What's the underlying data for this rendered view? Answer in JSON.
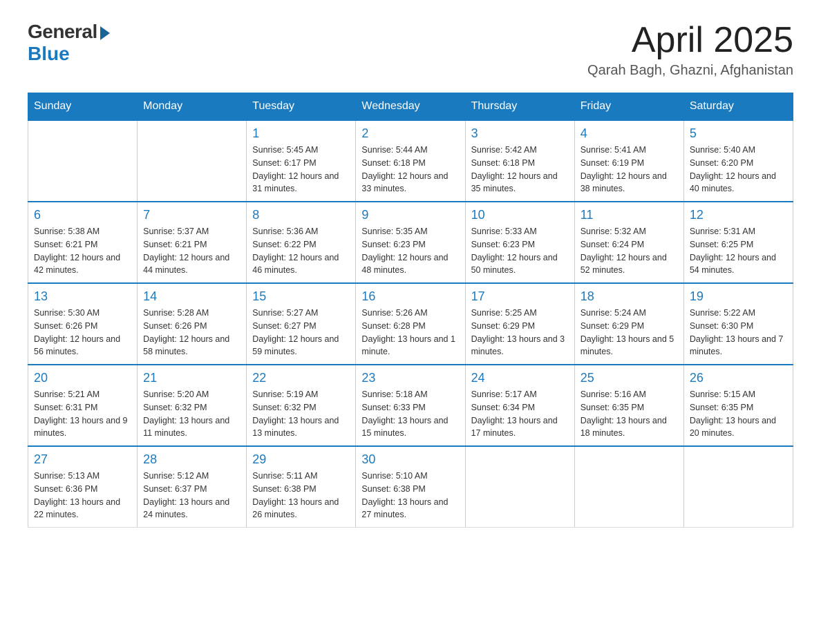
{
  "header": {
    "logo_general": "General",
    "logo_blue": "Blue",
    "month_title": "April 2025",
    "location": "Qarah Bagh, Ghazni, Afghanistan"
  },
  "calendar": {
    "days_of_week": [
      "Sunday",
      "Monday",
      "Tuesday",
      "Wednesday",
      "Thursday",
      "Friday",
      "Saturday"
    ],
    "weeks": [
      [
        {
          "day": "",
          "sunrise": "",
          "sunset": "",
          "daylight": ""
        },
        {
          "day": "",
          "sunrise": "",
          "sunset": "",
          "daylight": ""
        },
        {
          "day": "1",
          "sunrise": "Sunrise: 5:45 AM",
          "sunset": "Sunset: 6:17 PM",
          "daylight": "Daylight: 12 hours and 31 minutes."
        },
        {
          "day": "2",
          "sunrise": "Sunrise: 5:44 AM",
          "sunset": "Sunset: 6:18 PM",
          "daylight": "Daylight: 12 hours and 33 minutes."
        },
        {
          "day": "3",
          "sunrise": "Sunrise: 5:42 AM",
          "sunset": "Sunset: 6:18 PM",
          "daylight": "Daylight: 12 hours and 35 minutes."
        },
        {
          "day": "4",
          "sunrise": "Sunrise: 5:41 AM",
          "sunset": "Sunset: 6:19 PM",
          "daylight": "Daylight: 12 hours and 38 minutes."
        },
        {
          "day": "5",
          "sunrise": "Sunrise: 5:40 AM",
          "sunset": "Sunset: 6:20 PM",
          "daylight": "Daylight: 12 hours and 40 minutes."
        }
      ],
      [
        {
          "day": "6",
          "sunrise": "Sunrise: 5:38 AM",
          "sunset": "Sunset: 6:21 PM",
          "daylight": "Daylight: 12 hours and 42 minutes."
        },
        {
          "day": "7",
          "sunrise": "Sunrise: 5:37 AM",
          "sunset": "Sunset: 6:21 PM",
          "daylight": "Daylight: 12 hours and 44 minutes."
        },
        {
          "day": "8",
          "sunrise": "Sunrise: 5:36 AM",
          "sunset": "Sunset: 6:22 PM",
          "daylight": "Daylight: 12 hours and 46 minutes."
        },
        {
          "day": "9",
          "sunrise": "Sunrise: 5:35 AM",
          "sunset": "Sunset: 6:23 PM",
          "daylight": "Daylight: 12 hours and 48 minutes."
        },
        {
          "day": "10",
          "sunrise": "Sunrise: 5:33 AM",
          "sunset": "Sunset: 6:23 PM",
          "daylight": "Daylight: 12 hours and 50 minutes."
        },
        {
          "day": "11",
          "sunrise": "Sunrise: 5:32 AM",
          "sunset": "Sunset: 6:24 PM",
          "daylight": "Daylight: 12 hours and 52 minutes."
        },
        {
          "day": "12",
          "sunrise": "Sunrise: 5:31 AM",
          "sunset": "Sunset: 6:25 PM",
          "daylight": "Daylight: 12 hours and 54 minutes."
        }
      ],
      [
        {
          "day": "13",
          "sunrise": "Sunrise: 5:30 AM",
          "sunset": "Sunset: 6:26 PM",
          "daylight": "Daylight: 12 hours and 56 minutes."
        },
        {
          "day": "14",
          "sunrise": "Sunrise: 5:28 AM",
          "sunset": "Sunset: 6:26 PM",
          "daylight": "Daylight: 12 hours and 58 minutes."
        },
        {
          "day": "15",
          "sunrise": "Sunrise: 5:27 AM",
          "sunset": "Sunset: 6:27 PM",
          "daylight": "Daylight: 12 hours and 59 minutes."
        },
        {
          "day": "16",
          "sunrise": "Sunrise: 5:26 AM",
          "sunset": "Sunset: 6:28 PM",
          "daylight": "Daylight: 13 hours and 1 minute."
        },
        {
          "day": "17",
          "sunrise": "Sunrise: 5:25 AM",
          "sunset": "Sunset: 6:29 PM",
          "daylight": "Daylight: 13 hours and 3 minutes."
        },
        {
          "day": "18",
          "sunrise": "Sunrise: 5:24 AM",
          "sunset": "Sunset: 6:29 PM",
          "daylight": "Daylight: 13 hours and 5 minutes."
        },
        {
          "day": "19",
          "sunrise": "Sunrise: 5:22 AM",
          "sunset": "Sunset: 6:30 PM",
          "daylight": "Daylight: 13 hours and 7 minutes."
        }
      ],
      [
        {
          "day": "20",
          "sunrise": "Sunrise: 5:21 AM",
          "sunset": "Sunset: 6:31 PM",
          "daylight": "Daylight: 13 hours and 9 minutes."
        },
        {
          "day": "21",
          "sunrise": "Sunrise: 5:20 AM",
          "sunset": "Sunset: 6:32 PM",
          "daylight": "Daylight: 13 hours and 11 minutes."
        },
        {
          "day": "22",
          "sunrise": "Sunrise: 5:19 AM",
          "sunset": "Sunset: 6:32 PM",
          "daylight": "Daylight: 13 hours and 13 minutes."
        },
        {
          "day": "23",
          "sunrise": "Sunrise: 5:18 AM",
          "sunset": "Sunset: 6:33 PM",
          "daylight": "Daylight: 13 hours and 15 minutes."
        },
        {
          "day": "24",
          "sunrise": "Sunrise: 5:17 AM",
          "sunset": "Sunset: 6:34 PM",
          "daylight": "Daylight: 13 hours and 17 minutes."
        },
        {
          "day": "25",
          "sunrise": "Sunrise: 5:16 AM",
          "sunset": "Sunset: 6:35 PM",
          "daylight": "Daylight: 13 hours and 18 minutes."
        },
        {
          "day": "26",
          "sunrise": "Sunrise: 5:15 AM",
          "sunset": "Sunset: 6:35 PM",
          "daylight": "Daylight: 13 hours and 20 minutes."
        }
      ],
      [
        {
          "day": "27",
          "sunrise": "Sunrise: 5:13 AM",
          "sunset": "Sunset: 6:36 PM",
          "daylight": "Daylight: 13 hours and 22 minutes."
        },
        {
          "day": "28",
          "sunrise": "Sunrise: 5:12 AM",
          "sunset": "Sunset: 6:37 PM",
          "daylight": "Daylight: 13 hours and 24 minutes."
        },
        {
          "day": "29",
          "sunrise": "Sunrise: 5:11 AM",
          "sunset": "Sunset: 6:38 PM",
          "daylight": "Daylight: 13 hours and 26 minutes."
        },
        {
          "day": "30",
          "sunrise": "Sunrise: 5:10 AM",
          "sunset": "Sunset: 6:38 PM",
          "daylight": "Daylight: 13 hours and 27 minutes."
        },
        {
          "day": "",
          "sunrise": "",
          "sunset": "",
          "daylight": ""
        },
        {
          "day": "",
          "sunrise": "",
          "sunset": "",
          "daylight": ""
        },
        {
          "day": "",
          "sunrise": "",
          "sunset": "",
          "daylight": ""
        }
      ]
    ]
  }
}
